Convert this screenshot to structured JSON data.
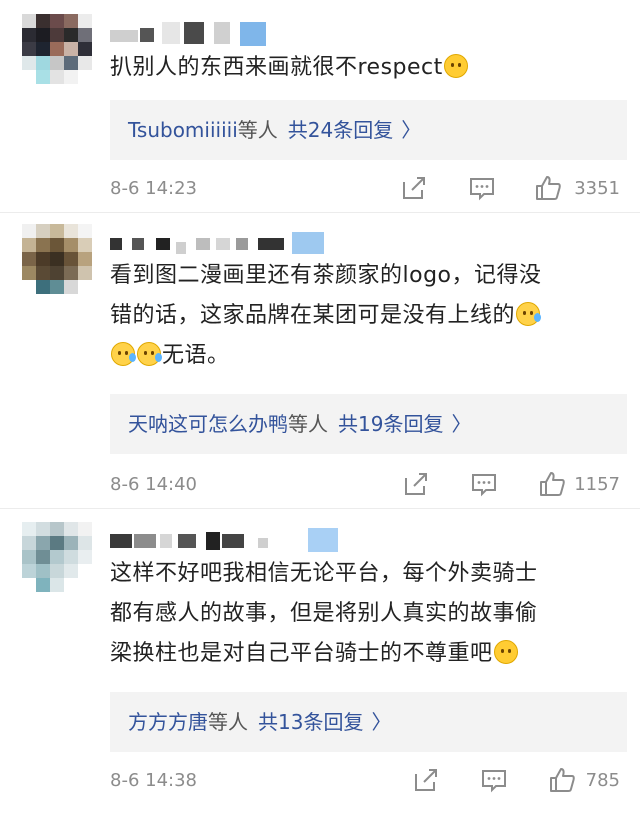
{
  "comments": [
    {
      "text_parts": [
        "扒别人的东西来画就很不respect"
      ],
      "replies_who": "Tsubomiiiiii",
      "replies_suffix": "等人",
      "replies_count": "共24条回复",
      "time": "8-6 14:23",
      "likes": "3351"
    },
    {
      "text_line1": "看到图二漫画里还有茶颜家的logo，记得没",
      "text_line2": "错的话，这家品牌在某团可是没有上线的",
      "text_line3": "无语。",
      "replies_who": "天呐这可怎么办鸭",
      "replies_suffix": "等人",
      "replies_count": "共19条回复",
      "time": "8-6 14:40",
      "likes": "1157"
    },
    {
      "text_line1": "这样不好吧我相信无论平台，每个外卖骑士",
      "text_line2": "都有感人的故事，但是将别人真实的故事偷",
      "text_line3": "梁换柱也是对自己平台骑士的不尊重吧",
      "replies_who": "方方方唐",
      "replies_suffix": "等人",
      "replies_count": "共13条回复",
      "time": "8-6 14:38",
      "likes": "785"
    }
  ],
  "icons": {
    "share": "share-icon",
    "comment": "comment-icon",
    "like": "thumbs-up-icon",
    "chevron": "chevron-right-icon",
    "emoji1": "grinning-sweat-emoji-icon",
    "emoji2": "crying-emoji-icon",
    "emoji3": "smiling-emoji-icon"
  },
  "colors": {
    "link": "#33539b",
    "meta": "#8c8c8c",
    "reply_bg": "#f3f3f3"
  },
  "chevron_glyph": "〉"
}
